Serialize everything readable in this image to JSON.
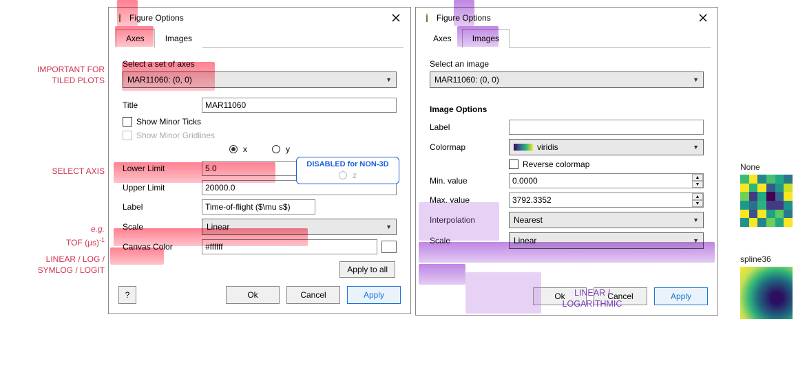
{
  "left_dialog": {
    "title": "Figure Options",
    "tabs": {
      "axes": "Axes",
      "images": "Images"
    },
    "select_label": "Select a set of axes",
    "select_value": "MAR11060: (0, 0)",
    "title_label": "Title",
    "title_value": "MAR11060",
    "show_minor_ticks": "Show Minor Ticks",
    "show_minor_gridlines": "Show Minor Gridlines",
    "radio_x": "x",
    "radio_y": "y",
    "radio_z": "z",
    "lower_label": "Lower Limit",
    "lower_value": "5.0",
    "upper_label": "Upper Limit",
    "upper_value": "20000.0",
    "axis_label_label": "Label",
    "axis_label_value": "Time-of-flight ($\\mu s$)",
    "scale_label": "Scale",
    "scale_value": "Linear",
    "canvas_label": "Canvas Color",
    "canvas_value": "#ffffff",
    "apply_all": "Apply to all",
    "help": "?",
    "ok": "Ok",
    "cancel": "Cancel",
    "apply": "Apply"
  },
  "right_dialog": {
    "title": "Figure Options",
    "tabs": {
      "axes": "Axes",
      "images": "Images"
    },
    "select_label": "Select an image",
    "select_value": "MAR11060: (0, 0)",
    "section": "Image Options",
    "label_label": "Label",
    "label_value": "",
    "colormap_label": "Colormap",
    "colormap_value": "viridis",
    "reverse_cmap": "Reverse colormap",
    "min_label": "Min. value",
    "min_value": "0.0000",
    "max_label": "Max. value",
    "max_value": "3792.3352",
    "interp_label": "Interpolation",
    "interp_value": "Nearest",
    "scale_label": "Scale",
    "scale_value": "Linear",
    "ok": "Ok",
    "cancel": "Cancel",
    "apply": "Apply"
  },
  "annotations": {
    "important": "IMPORTANT FOR\nTILED PLOTS",
    "select_axis": "SELECT AXIS",
    "eg": "e.g.",
    "tof": "TOF (μs)",
    "tof_inv": "-1",
    "scales": "LINEAR / LOG /\nSYMLOG / LOGIT",
    "disabled3d": "DISABLED for NON-3D",
    "purple_scales": "LINEAR /\nLOGARITHMIC",
    "thumb_none": "None",
    "thumb_spline": "spline36"
  }
}
